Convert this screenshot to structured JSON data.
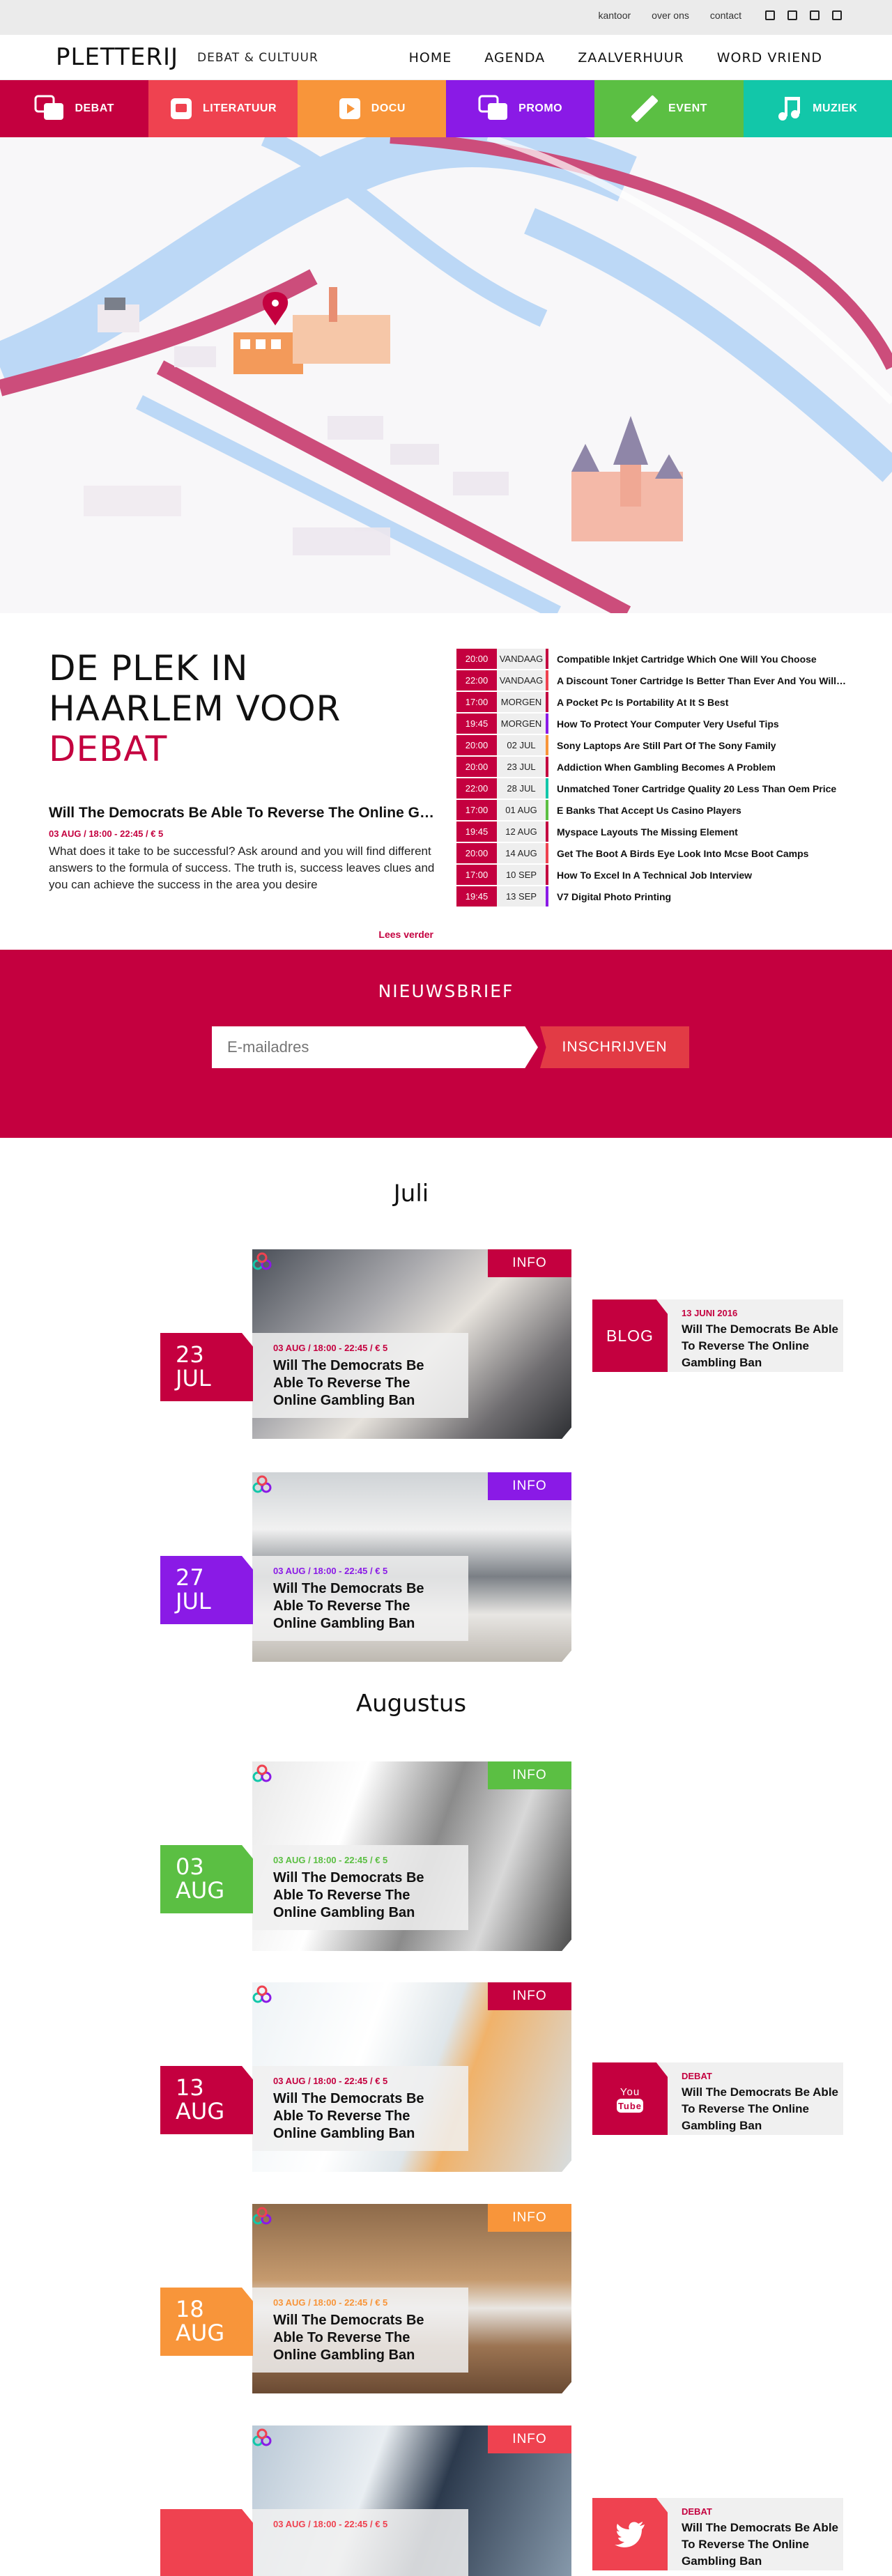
{
  "topbar": {
    "links": [
      "kantoor",
      "over ons",
      "contact"
    ],
    "social": [
      "facebook-icon",
      "linkedin-icon",
      "twitter-icon",
      "youtube-icon"
    ]
  },
  "header": {
    "logo": "PLETTERIJ",
    "tagline": "DEBAT & CULTUUR",
    "nav": [
      "HOME",
      "AGENDA",
      "ZAALVERHUUR",
      "WORD VRIEND"
    ]
  },
  "categories": [
    {
      "label": "DEBAT",
      "color": "#c4003f",
      "icon": "chat-bubbles-icon"
    },
    {
      "label": "LITERATUUR",
      "color": "#ef4250",
      "icon": "book-icon"
    },
    {
      "label": "DOCU",
      "color": "#f8953a",
      "icon": "play-icon"
    },
    {
      "label": "PROMO",
      "color": "#8a1ae6",
      "icon": "chat-bubbles-icon"
    },
    {
      "label": "EVENT",
      "color": "#5bbf43",
      "icon": "ticket-icon"
    },
    {
      "label": "MUZIEK",
      "color": "#12c7a9",
      "icon": "music-note-icon"
    }
  ],
  "intro": {
    "title_line1": "DE PLEK IN",
    "title_line2": "HAARLEM VOOR",
    "title_highlight": "DEBAT",
    "featured": {
      "title": "Will The Democrats Be Able To Reverse The Online Gambling Ban",
      "meta": "03 AUG / 18:00 - 22:45 / € 5",
      "text": "What does it take to be successful? Ask around and you will find different answers to the formula of success. The truth is, success leaves clues and you can achieve the success in the area you desire",
      "more": "Lees verder"
    }
  },
  "schedule": [
    {
      "time": "20:00",
      "day": "VANDAAG",
      "color": "#c4003f",
      "title": "Compatible Inkjet Cartridge Which One Will You Choose"
    },
    {
      "time": "22:00",
      "day": "VANDAAG",
      "color": "#ef4250",
      "title": "A Discount Toner Cartridge Is Better Than Ever And You Will Save"
    },
    {
      "time": "17:00",
      "day": "MORGEN",
      "color": "#c4003f",
      "title": "A Pocket Pc Is Portability At It S Best"
    },
    {
      "time": "19:45",
      "day": "MORGEN",
      "color": "#8a1ae6",
      "title": "How To Protect Your Computer Very Useful Tips"
    },
    {
      "time": "20:00",
      "day": "02 JUL",
      "color": "#f8953a",
      "title": "Sony Laptops Are Still Part Of The Sony Family"
    },
    {
      "time": "20:00",
      "day": "23 JUL",
      "color": "#c4003f",
      "title": "Addiction When Gambling Becomes A Problem"
    },
    {
      "time": "22:00",
      "day": "28 JUL",
      "color": "#12c7a9",
      "title": "Unmatched Toner Cartridge Quality 20 Less Than Oem Price"
    },
    {
      "time": "17:00",
      "day": "01 AUG",
      "color": "#5bbf43",
      "title": "E Banks That Accept Us Casino Players"
    },
    {
      "time": "19:45",
      "day": "12 AUG",
      "color": "#c4003f",
      "title": "Myspace Layouts The Missing Element"
    },
    {
      "time": "20:00",
      "day": "14 AUG",
      "color": "#ef4250",
      "title": "Get The Boot A Birds Eye Look Into Mcse Boot Camps"
    },
    {
      "time": "17:00",
      "day": "10 SEP",
      "color": "#c4003f",
      "title": "How To Excel In A Technical Job Interview"
    },
    {
      "time": "19:45",
      "day": "13 SEP",
      "color": "#8a1ae6",
      "title": "V7 Digital Photo Printing"
    }
  ],
  "newsletter": {
    "title": "NIEUWSBRIEF",
    "placeholder": "E-mailadres",
    "button": "INSCHRIJVEN"
  },
  "months": [
    "Juli",
    "Augustus"
  ],
  "events": [
    {
      "day": "23",
      "month": "JUL",
      "color": "#c4003f",
      "badge": "INFO",
      "meta": "03 AUG / 18:00 - 22:45 / € 5",
      "title": "Will The Democrats Be Able To Reverse The Online Gambling Ban",
      "scene": "map"
    },
    {
      "day": "27",
      "month": "JUL",
      "color": "#8a1ae6",
      "badge": "INFO",
      "meta": "03 AUG / 18:00 - 22:45 / € 5",
      "title": "Will The Democrats Be Able To Reverse The Online Gambling Ban",
      "scene": "interior"
    },
    {
      "day": "03",
      "month": "AUG",
      "color": "#5bbf43",
      "badge": "INFO",
      "meta": "03 AUG / 18:00 - 22:45 / € 5",
      "title": "Will The Democrats Be Able To Reverse The Online Gambling Ban",
      "scene": "suit"
    },
    {
      "day": "13",
      "month": "AUG",
      "color": "#c4003f",
      "badge": "INFO",
      "meta": "03 AUG / 18:00 - 22:45 / € 5",
      "title": "Will The Democrats Be Able To Reverse The Online Gambling Ban",
      "scene": "office"
    },
    {
      "day": "18",
      "month": "AUG",
      "color": "#f8953a",
      "badge": "INFO",
      "meta": "03 AUG / 18:00 - 22:45 / € 5",
      "title": "Will The Democrats Be Able To Reverse The Online Gambling Ban",
      "scene": "laptop"
    },
    {
      "day": "",
      "month": "",
      "color": "#ef4250",
      "badge": "INFO",
      "meta": "03 AUG / 18:00 - 22:45 / € 5",
      "title": "",
      "scene": "woman"
    }
  ],
  "side_cards": [
    {
      "tag": "BLOG",
      "tag_color": "#c4003f",
      "meta": "13 JUNI 2016",
      "title": "Will The Democrats Be Able To Reverse The Online Gambling Ban"
    },
    {
      "tag": "",
      "tag_color": "#c4003f",
      "icon": "youtube-icon",
      "meta": "DEBAT",
      "title": "Will The Democrats Be Able To Reverse The Online Gambling Ban"
    },
    {
      "tag": "",
      "tag_color": "#ef4250",
      "icon": "twitter-icon",
      "meta": "DEBAT",
      "title": "Will The Democrats Be Able To Reverse The Online Gambling Ban"
    }
  ]
}
